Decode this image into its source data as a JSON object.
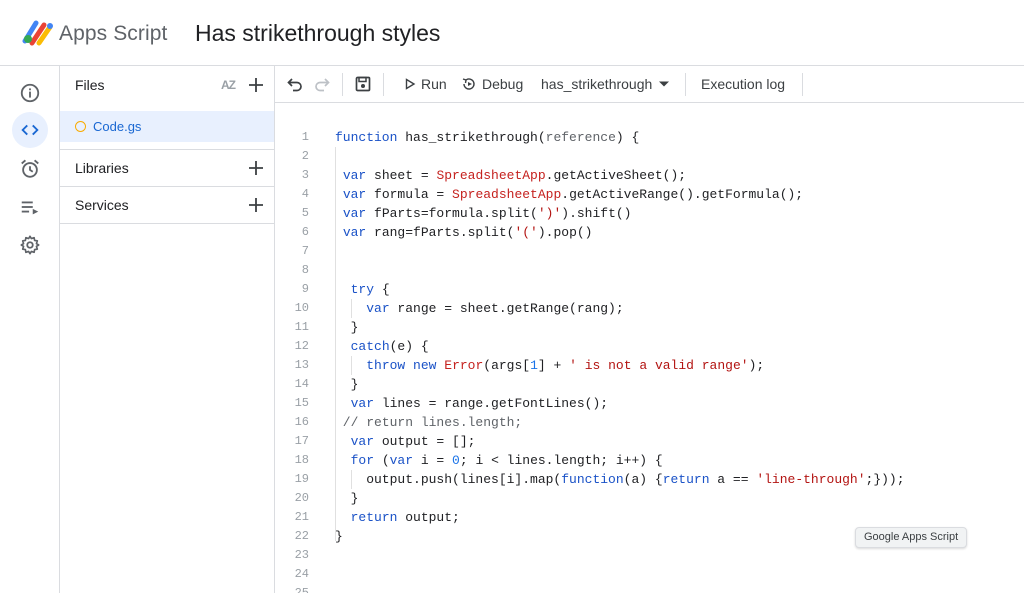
{
  "header": {
    "app_name": "Apps Script",
    "project_title": "Has strikethrough styles"
  },
  "rail": {
    "items": [
      {
        "icon": "info-icon",
        "name": "Overview"
      },
      {
        "icon": "code-icon",
        "name": "Editor",
        "active": true
      },
      {
        "icon": "alarm-clock-icon",
        "name": "Triggers"
      },
      {
        "icon": "executions-icon",
        "name": "Executions"
      },
      {
        "icon": "gear-icon",
        "name": "Project Settings"
      }
    ]
  },
  "files_panel": {
    "files_label": "Files",
    "sort_label": "AZ",
    "file_name": "Code.gs",
    "libraries_label": "Libraries",
    "services_label": "Services"
  },
  "toolbar": {
    "run_label": "Run",
    "debug_label": "Debug",
    "function_name": "has_strikethrough",
    "execution_log_label": "Execution log"
  },
  "editor": {
    "line_numbers": [
      "1",
      "2",
      "3",
      "4",
      "5",
      "6",
      "7",
      "8",
      "9",
      "10",
      "11",
      "12",
      "13",
      "14",
      "15",
      "16",
      "17",
      "18",
      "19",
      "20",
      "21",
      "22",
      "23",
      "24",
      "25"
    ],
    "code_lines": [
      "function has_strikethrough(reference) {",
      "",
      " var sheet = SpreadsheetApp.getActiveSheet();",
      " var formula = SpreadsheetApp.getActiveRange().getFormula();",
      " var fParts=formula.split(')').shift()",
      " var rang=fParts.split('(').pop()",
      "",
      "",
      "  try {",
      "    var range = sheet.getRange(rang);",
      "  }",
      "  catch(e) {",
      "    throw new Error(args[1] + ' is not a valid range');",
      "  }",
      "  var lines = range.getFontLines();",
      " // return lines.length;",
      "  var output = [];",
      "  for (var i = 0; i < lines.length; i++) {",
      "    output.push(lines[i].map(function(a) {return a == 'line-through';}));",
      "  }",
      "  return output;",
      "}",
      "",
      "",
      ""
    ]
  },
  "tooltip": {
    "text": "Google Apps Script"
  },
  "colors": {
    "accent": "#1a73e8",
    "active_bg": "#e8f0fe",
    "keyword": "#1a52c7",
    "string": "#b31412",
    "class": "#c5221f"
  }
}
